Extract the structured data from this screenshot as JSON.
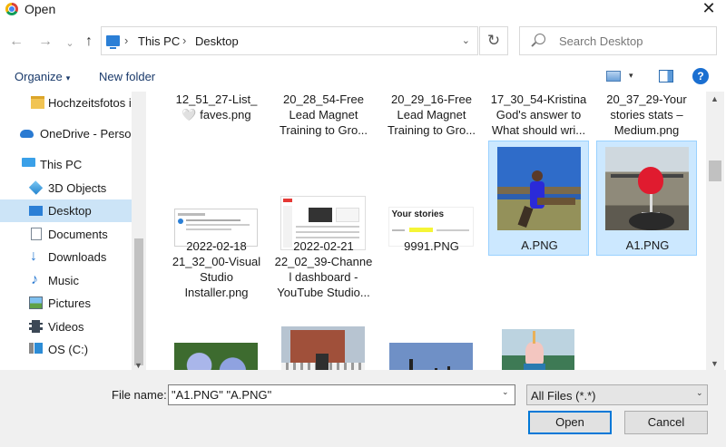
{
  "window": {
    "title": "Open",
    "close_glyph": "✕"
  },
  "nav": {
    "back_glyph": "←",
    "forward_glyph": "→",
    "up_glyph": "↑",
    "recent_glyph": "⌄"
  },
  "address": {
    "breadcrumbs": [
      "This PC",
      "Desktop"
    ],
    "separator": "›",
    "dropdown_glyph": "⌄",
    "refresh_glyph": "↻"
  },
  "search": {
    "placeholder": "Search Desktop"
  },
  "toolbar": {
    "organize_label": "Organize",
    "caret": "▾",
    "new_folder_label": "New folder",
    "help_glyph": "?"
  },
  "sidebar": {
    "items": [
      {
        "label": "Hochzeitsfotos in",
        "icon": "folder-icon",
        "indent": 1
      },
      {
        "label": "OneDrive - Person",
        "icon": "onedrive-cloud-icon",
        "indent": 0
      },
      {
        "label": "This PC",
        "icon": "pc-icon",
        "indent": 0
      },
      {
        "label": "3D Objects",
        "icon": "3d-objects-icon",
        "indent": 1
      },
      {
        "label": "Desktop",
        "icon": "desktop-icon",
        "indent": 1,
        "selected": true
      },
      {
        "label": "Documents",
        "icon": "documents-icon",
        "indent": 1
      },
      {
        "label": "Downloads",
        "icon": "downloads-icon",
        "indent": 1
      },
      {
        "label": "Music",
        "icon": "music-icon",
        "indent": 1
      },
      {
        "label": "Pictures",
        "icon": "pictures-icon",
        "indent": 1
      },
      {
        "label": "Videos",
        "icon": "videos-icon",
        "indent": 1
      },
      {
        "label": "OS (C:)",
        "icon": "os-drive-icon",
        "indent": 1
      }
    ]
  },
  "files": [
    {
      "name": "12_51_27-List_\n🤍 faves.png",
      "thumb": "none"
    },
    {
      "name": "20_28_54-Free\nLead Magnet\nTraining to Gro...",
      "thumb": "none"
    },
    {
      "name": "20_29_16-Free\nLead Magnet\nTraining to Gro...",
      "thumb": "none"
    },
    {
      "name": "17_30_54-Kristina\nGod's answer to\nWhat should wri...",
      "thumb": "none"
    },
    {
      "name": "20_37_29-Your\nstories stats –\nMedium.png",
      "thumb": "none"
    },
    {
      "name": "2022-02-18\n21_32_00-Visual\nStudio\nInstaller.png",
      "thumb": "installer-screenshot"
    },
    {
      "name": "2022-02-21\n22_02_39-Channe\nl dashboard -\nYouTube Studio...",
      "thumb": "youtube-screenshot"
    },
    {
      "name": "9991.PNG",
      "thumb": "your-stories-screenshot",
      "thumb_text": "Your stories"
    },
    {
      "name": "A.PNG",
      "thumb": "woman-photo",
      "selected": true
    },
    {
      "name": "A1.PNG",
      "thumb": "drink-photo",
      "selected": true
    },
    {
      "name": "",
      "thumb": "hydrangea-photo"
    },
    {
      "name": "",
      "thumb": "house-photo"
    },
    {
      "name": "",
      "thumb": "beach-photo"
    },
    {
      "name": "",
      "thumb": "icecream-photo"
    },
    {
      "name": "",
      "thumb": "doc-screenshot"
    }
  ],
  "bottom": {
    "file_name_label": "File name:",
    "file_name_value": "\"A1.PNG\" \"A.PNG\"",
    "file_type_value": "All Files (*.*)",
    "open_label": "Open",
    "cancel_label": "Cancel",
    "drop_glyph": "⌄"
  }
}
